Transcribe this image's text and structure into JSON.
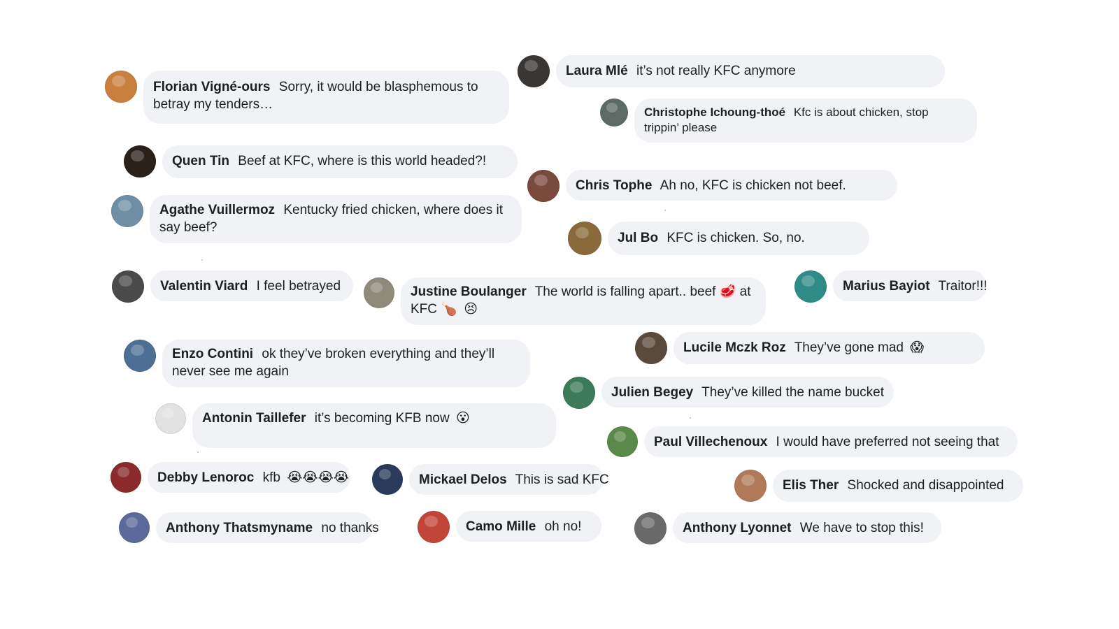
{
  "comments": [
    {
      "author": "Florian Vigné-ours",
      "text": "Sorry, it would be blasphemous to betray my tenders…",
      "emoji": "",
      "avatar_color": "#c9803f"
    },
    {
      "author": "Laura Mlé",
      "text": "it’s not really KFC anymore",
      "emoji": "",
      "avatar_color": "#3a3634"
    },
    {
      "author": "Christophe Ichoung-thoé",
      "text": "Kfc is about chicken, stop trippin’ please",
      "emoji": "",
      "avatar_color": "#5d6b66"
    },
    {
      "author": "Quen Tin",
      "text": "Beef at KFC, where is this world headed?!",
      "emoji": "",
      "avatar_color": "#2b211b"
    },
    {
      "author": "Chris Tophe",
      "text": "Ah no, KFC is chicken not beef.",
      "emoji": "",
      "avatar_color": "#7a4a3c"
    },
    {
      "author": "Agathe Vuillermoz",
      "text": "Kentucky fried chicken, where does it say beef?",
      "emoji": "",
      "avatar_color": "#6f8fa6"
    },
    {
      "author": "Jul Bo",
      "text": "KFC is chicken. So, no.",
      "emoji": "",
      "avatar_color": "#8a6a3a"
    },
    {
      "author": "Valentin Viard",
      "text": "I feel betrayed",
      "emoji": "",
      "avatar_color": "#4a4a4a"
    },
    {
      "author": "Justine Boulanger",
      "text": "The world is falling apart.. beef 🥩 at KFC 🍗",
      "emoji": "😣",
      "avatar_color": "#8f8a7a"
    },
    {
      "author": "Marius Bayiot",
      "text": "Traitor!!!",
      "emoji": "",
      "avatar_color": "#2e8b86"
    },
    {
      "author": "Enzo Contini",
      "text": "ok they’ve broken everything and they’ll never see me again",
      "emoji": "",
      "avatar_color": "#4d6f96"
    },
    {
      "author": "Lucile Mczk Roz",
      "text": "They’ve gone mad",
      "emoji": "😱",
      "avatar_color": "#5a4a3c"
    },
    {
      "author": "Julien Begey",
      "text": "They’ve killed the name bucket",
      "emoji": "",
      "avatar_color": "#3c7a58"
    },
    {
      "author": "Antonin Taillefer",
      "text": "it’s becoming KFB now",
      "emoji": "😮",
      "avatar_color": "#e2e2e2"
    },
    {
      "author": "Paul Villechenoux",
      "text": "I would have preferred not seeing that",
      "emoji": "",
      "avatar_color": "#5a8a4a"
    },
    {
      "author": "Debby Lenoroc",
      "text": "kfb",
      "emoji": "😭😭😭😭",
      "avatar_color": "#8a2a2a"
    },
    {
      "author": "Mickael Delos",
      "text": "This is sad KFC",
      "emoji": "",
      "avatar_color": "#2a3a5c"
    },
    {
      "author": "Elis Ther",
      "text": "Shocked and disappointed",
      "emoji": "",
      "avatar_color": "#b07a5a"
    },
    {
      "author": "Anthony Thatsmyname",
      "text": "no thanks",
      "emoji": "",
      "avatar_color": "#5a6a9a"
    },
    {
      "author": "Camo Mille",
      "text": "oh no!",
      "emoji": "",
      "avatar_color": "#c2453a"
    },
    {
      "author": "Anthony Lyonnet",
      "text": "We have to stop this!",
      "emoji": "",
      "avatar_color": "#6a6a6a"
    }
  ]
}
